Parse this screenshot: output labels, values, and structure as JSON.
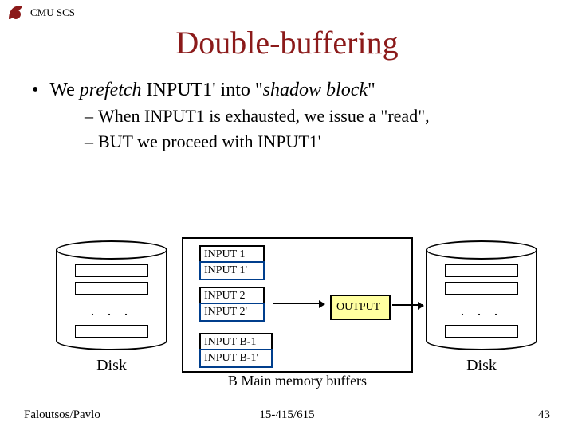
{
  "header": {
    "org": "CMU SCS"
  },
  "title": "Double-buffering",
  "bullet": {
    "pre": "We ",
    "em1": "prefetch",
    "mid": " INPUT1' into \"",
    "em2": "shadow block",
    "post": "\""
  },
  "sub1": "When INPUT1 is exhausted, we issue a \"read\",",
  "sub2": "BUT we proceed with INPUT1'",
  "diagram": {
    "disk_left": "Disk",
    "disk_right": "Disk",
    "dots": ". . .",
    "input1": "INPUT 1",
    "input1p": "INPUT 1'",
    "input2": "INPUT 2",
    "input2p": "INPUT 2'",
    "inputB": "INPUT B-1",
    "inputBp": "INPUT B-1'",
    "output": "OUTPUT",
    "caption": "B Main memory buffers"
  },
  "footer": {
    "left": "Faloutsos/Pavlo",
    "mid": "15-415/615",
    "right": "43"
  }
}
